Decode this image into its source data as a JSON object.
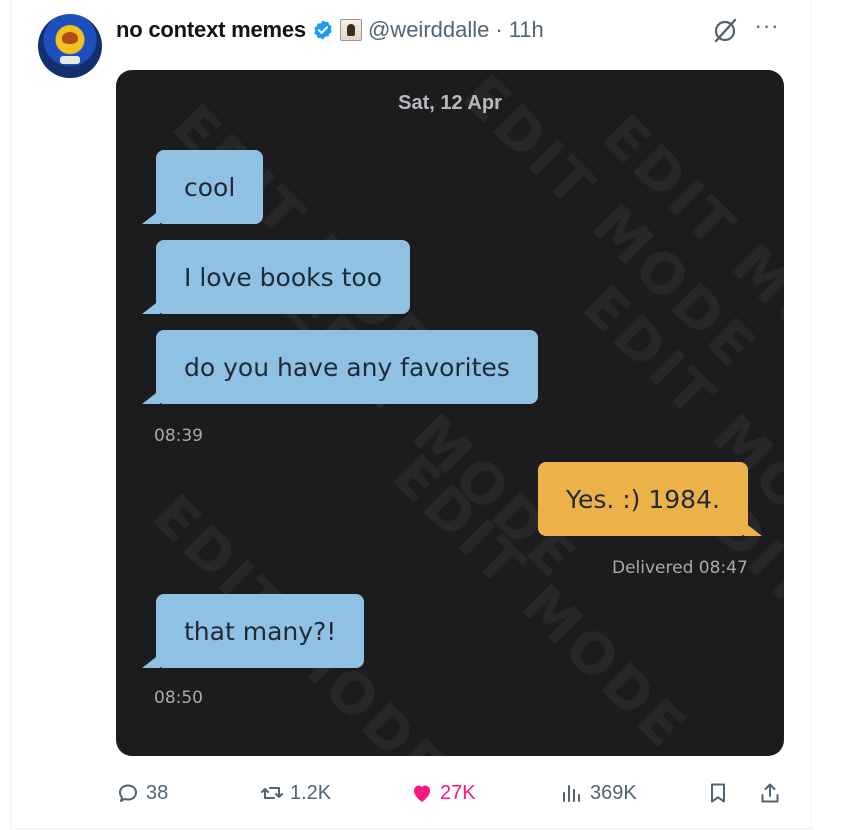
{
  "post": {
    "author_name": "no context memes",
    "handle": "@weirddalle",
    "separator": "·",
    "time_ago": "11h"
  },
  "media": {
    "date_header": "Sat, 12 Apr",
    "watermark_text": "EDIT MODE",
    "messages": [
      {
        "text": "cool",
        "direction": "incoming"
      },
      {
        "text": "I love books too",
        "direction": "incoming"
      },
      {
        "text": "do you have any favorites",
        "direction": "incoming"
      },
      {
        "text": "Yes. :) 1984.",
        "direction": "outgoing"
      },
      {
        "text": "that many?!",
        "direction": "incoming"
      }
    ],
    "timestamps": {
      "first_group": "08:39",
      "delivered": "Delivered 08:47",
      "last": "08:50"
    }
  },
  "actions": {
    "replies": "38",
    "reposts": "1.2K",
    "likes": "27K",
    "views": "369K"
  },
  "icons": {
    "reply": "reply-icon",
    "repost": "repost-icon",
    "like": "heart-icon",
    "views": "views-chart-icon",
    "bookmark": "bookmark-icon",
    "share": "share-icon",
    "grok": "grok-icon",
    "more": "more-icon",
    "verified": "verified-badge-icon"
  },
  "colors": {
    "like_pink": "#f91880",
    "verified_blue": "#1d9bf0",
    "bubble_incoming": "#8fc1e3",
    "bubble_outgoing": "#ecb248",
    "chat_background": "#1c1c1e"
  }
}
